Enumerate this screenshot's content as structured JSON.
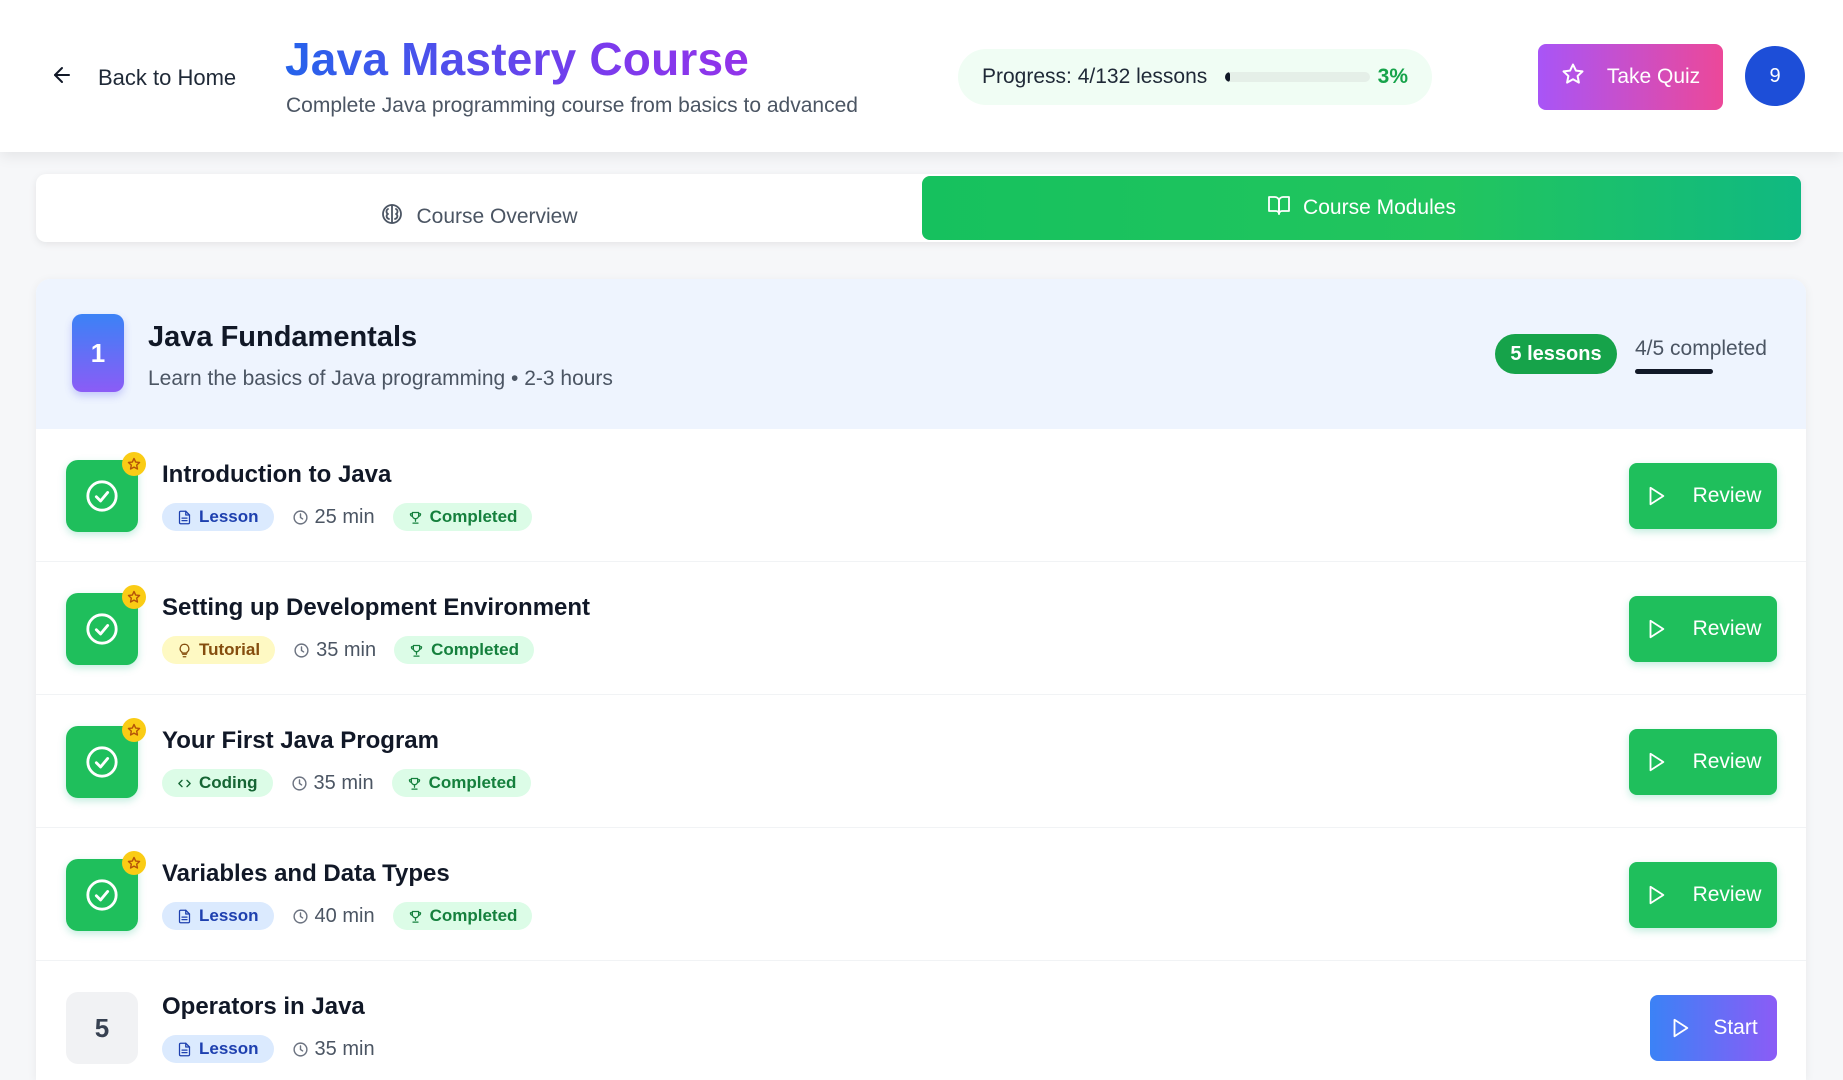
{
  "header": {
    "back_label": "Back to Home",
    "title": "Java Mastery Course",
    "subtitle": "Complete Java programming course from basics to advanced",
    "progress_label": "Progress: 4/132 lessons",
    "progress_fraction": 0.03,
    "progress_percent": "3%",
    "quiz_label": "Take Quiz",
    "avatar_text": "9"
  },
  "tabs": [
    {
      "label": "Course Overview",
      "icon": "brain-icon",
      "active": false
    },
    {
      "label": "Course Modules",
      "icon": "book-open-icon",
      "active": true
    }
  ],
  "module": {
    "number": "1",
    "title": "Java Fundamentals",
    "description": "Learn the basics of Java programming • 2-3 hours",
    "lessons_badge": "5 lessons",
    "completed_label": "4/5 completed"
  },
  "lessons": [
    {
      "title": "Introduction to Java",
      "type": "Lesson",
      "duration": "25 min",
      "status": "Completed",
      "action": "Review"
    },
    {
      "title": "Setting up Development Environment",
      "type": "Tutorial",
      "duration": "35 min",
      "status": "Completed",
      "action": "Review"
    },
    {
      "title": "Your First Java Program",
      "type": "Coding",
      "duration": "35 min",
      "status": "Completed",
      "action": "Review"
    },
    {
      "title": "Variables and Data Types",
      "type": "Lesson",
      "duration": "40 min",
      "status": "Completed",
      "action": "Review"
    },
    {
      "title": "Operators in Java",
      "type": "Lesson",
      "duration": "35 min",
      "number": "5",
      "action": "Start"
    }
  ],
  "colors": {
    "accent_green": "#1fbf5c",
    "accent_blue": "#3b82f6",
    "accent_purple": "#8b5cf6",
    "quiz_pink": "#ec4899"
  }
}
